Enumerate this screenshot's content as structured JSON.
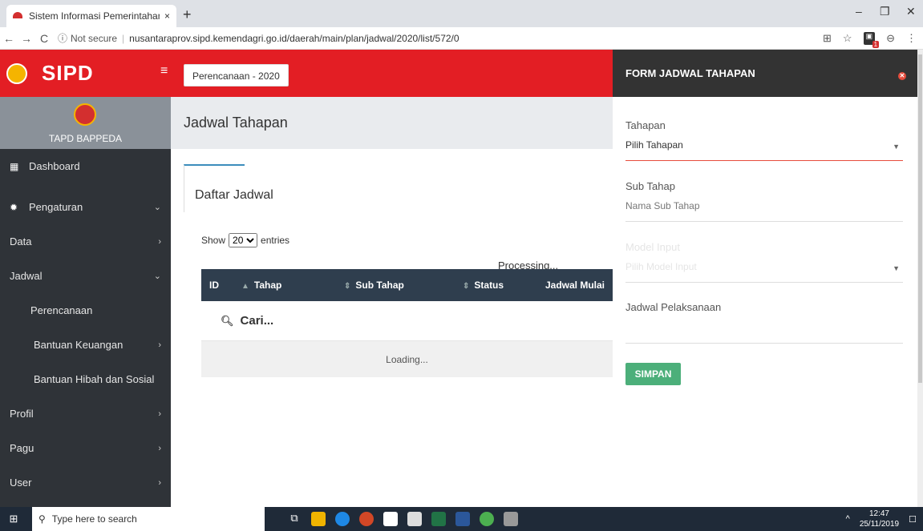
{
  "browser": {
    "tab_title": "Sistem Informasi Pemerintahan D",
    "tab_close": "×",
    "new_tab": "+",
    "security_label": "Not secure",
    "url": "nusantaraprov.sipd.kemendagri.go.id/daerah/main/plan/jadwal/2020/list/572/0",
    "window_controls": [
      "–",
      "❐",
      "✕"
    ],
    "extension_badge_count": "1"
  },
  "header": {
    "logo_text": "SIPD",
    "period_button": "Perencanaan - 2020"
  },
  "sidebar": {
    "profile_name": "TAPD BAPPEDA",
    "items": [
      {
        "label": "Dashboard",
        "icon": "dashboard-icon"
      },
      {
        "label": "Pengaturan",
        "icon": "gear-icon",
        "chevron": "⌄"
      },
      {
        "label": "Data",
        "chevron": "›"
      },
      {
        "label": "Jadwal",
        "chevron": "⌄"
      },
      {
        "label": "Perencanaan"
      },
      {
        "label": "Bantuan Keuangan",
        "chevron": "›"
      },
      {
        "label": "Bantuan Hibah dan Sosial"
      },
      {
        "label": "Profil",
        "chevron": "›"
      },
      {
        "label": "Pagu",
        "chevron": "›"
      },
      {
        "label": "User",
        "chevron": "›"
      }
    ]
  },
  "main": {
    "page_title": "Jadwal Tahapan",
    "card_title": "Daftar Jadwal",
    "show_label": "Show",
    "entries_value": "20",
    "entries_label": "entries",
    "processing": "Processing...",
    "columns": [
      "ID",
      "Tahap",
      "Sub Tahap",
      "Status",
      "Jadwal Mulai"
    ],
    "search_placeholder": "Cari...",
    "loading": "Loading..."
  },
  "form": {
    "title": "FORM JADWAL TAHAPAN",
    "tahapan_label": "Tahapan",
    "tahapan_value": "Pilih Tahapan",
    "subtahap_label": "Sub Tahap",
    "subtahap_placeholder": "Nama Sub Tahap",
    "model_label": "Model Input",
    "model_value": "Pilih Model Input",
    "jadwal_label": "Jadwal Pelaksanaan",
    "submit_label": "SIMPAN"
  },
  "taskbar": {
    "search_placeholder": "Type here to search",
    "time": "12:47",
    "date": "25/11/2019"
  },
  "colors": {
    "brand_red": "#e31e24",
    "sidebar_bg": "#2f3338",
    "table_header": "#2f3e4e",
    "submit_green": "#4caf7a"
  }
}
